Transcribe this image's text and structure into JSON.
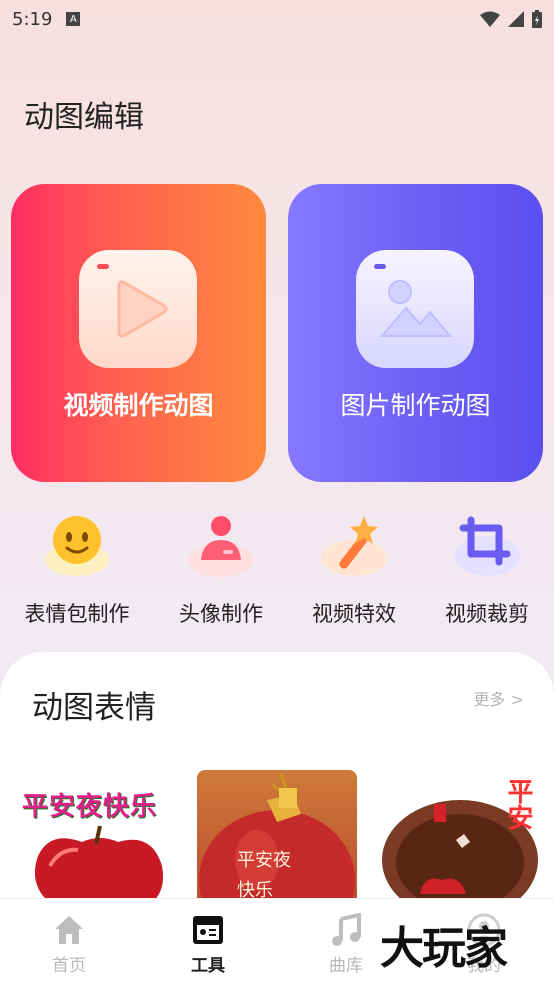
{
  "status": {
    "time": "5:19",
    "a_badge": "A"
  },
  "header": {
    "title": "动图编辑"
  },
  "cards": [
    {
      "label": "视频制作动图",
      "icon": "play-icon"
    },
    {
      "label": "图片制作动图",
      "icon": "image-icon"
    }
  ],
  "tools": [
    {
      "label": "表情包制作",
      "icon": "emoji-face-icon"
    },
    {
      "label": "头像制作",
      "icon": "avatar-person-icon"
    },
    {
      "label": "视频特效",
      "icon": "magic-wand-icon"
    },
    {
      "label": "视频裁剪",
      "icon": "crop-icon"
    }
  ],
  "section": {
    "title": "动图表情",
    "more": "更多 >"
  },
  "thumbnails": [
    {
      "text": "平安夜快乐"
    },
    {
      "line1": "平安夜",
      "line2": "快乐"
    },
    {
      "text": "平安"
    }
  ],
  "nav": [
    {
      "label": "首页",
      "icon": "home-icon"
    },
    {
      "label": "工具",
      "icon": "toolbox-icon"
    },
    {
      "label": "曲库",
      "icon": "music-note-icon"
    },
    {
      "label": "我的",
      "icon": "profile-icon"
    }
  ],
  "watermark": "大玩家",
  "colors": {
    "video_card_start": "#ff2d62",
    "video_card_end": "#ff8a3e",
    "image_card_start": "#8678ff",
    "image_card_end": "#5b4ef0"
  }
}
